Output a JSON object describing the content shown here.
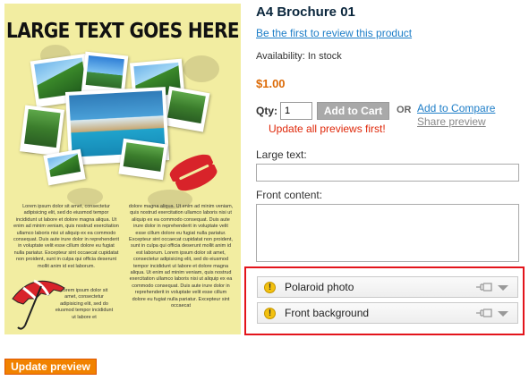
{
  "brochure": {
    "headline": "LARGE TEXT GOES HERE",
    "col1_text": "Lorem ipsum dolor sit amet, consectetur adipisicing elit, sed do eiusmod tempor incididunt ut labore et dolore magna aliqua. Ut enim ad minim veniam, quis nostrud exercitation ullamco laboris nisi ut aliquip ex ea commodo consequat. Duis aute irure dolor in reprehenderit in voluptate velit esse cillum dolore eu fugiat nulla pariatur. Excepteur sint occaecat cupidatat non proident, sunt in culpa qui officia deserunt mollit anim id est laborum.",
    "col1b_text": "Lorem ipsum dolor sit amet, consectetur adipisicing elit, sed do eiusmod tempor incididunt ut labore et",
    "col2_text": "dolore magna aliqua. Ut enim ad minim veniam, quis nostrud exercitation ullamco laboris nisi ut aliquip ex ea commodo consequat. Duis aute irure dolor in reprehenderit in voluptate velit esse cillum dolore eu fugiat nulla pariatur. Excepteur sint occaecat cupidatat non proident, sunt in culpa qui officia deserunt mollit anim id est laborum. Lorem ipsum dolor sit amet, consectetur adipisicing elit, sed do eiusmod tempor incididunt ut labore et dolore magna aliqua. Ut enim ad minim veniam, quis nostrud exercitation ullamco laboris nisi ut aliquip ex ea commodo consequat. Duis aute irure dolor in reprehenderit in voluptate velit esse cillum dolore eu fugiat nulla pariatur. Excepteur sint occaecat"
  },
  "product": {
    "title": "A4 Brochure 01",
    "review_link": "Be the first to review this product",
    "availability": "Availability: In stock",
    "price": "$1.00"
  },
  "cart": {
    "qty_label": "Qty:",
    "qty_value": "1",
    "add_to_cart": "Add to Cart",
    "or_text": "OR",
    "compare_link": "Add to Compare",
    "share_link": "Share preview",
    "warning": "Update all previews first!"
  },
  "form": {
    "large_text_label": "Large text:",
    "front_content_label": "Front content:"
  },
  "panels": [
    {
      "label": "Polaroid photo",
      "icon": "warning-icon"
    },
    {
      "label": "Front background",
      "icon": "warning-icon"
    }
  ],
  "update_button": "Update preview",
  "colors": {
    "accent_orange": "#f18200",
    "price_orange": "#dc6a06",
    "link_blue": "#1e7ec8",
    "warning_red": "#df280a",
    "highlight_red": "#e3141b"
  }
}
